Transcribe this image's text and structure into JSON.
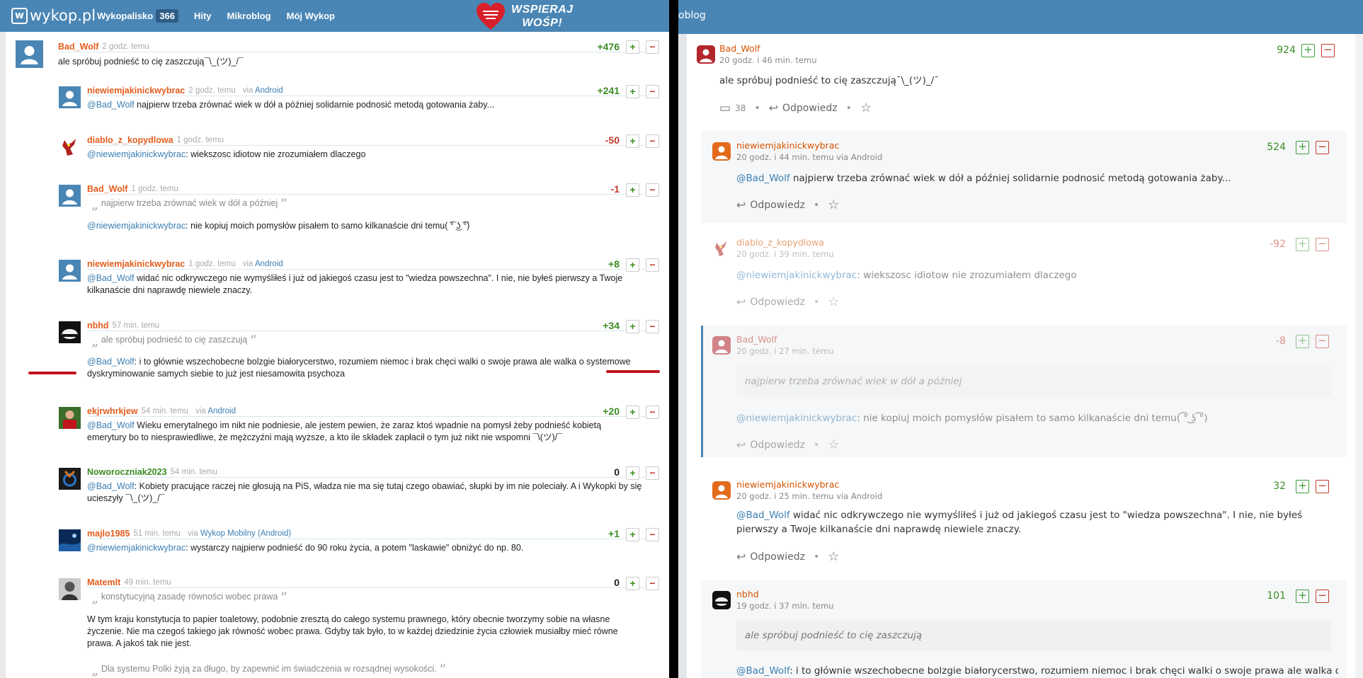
{
  "left": {
    "logo": "wykop.pl",
    "nav": {
      "wykopalisko": "Wykopalisko",
      "wykopalisko_count": "366",
      "hity": "Hity",
      "mikroblog": "Mikroblog",
      "moj_wykop": "Mój Wykop"
    },
    "banner": {
      "line1": "WSPIERAJ",
      "line2": "WOŚP!"
    },
    "entries": [
      {
        "nick": "Bad_Wolf",
        "time": "2 godz. temu",
        "score": "+476",
        "body": "ale spróbuj podnieść to cię zaszczują¯\\_(ツ)_/¯"
      },
      {
        "nick": "niewiemjakinickwybrac",
        "time": "2 godz. temu",
        "via_label": "via",
        "via": "Android",
        "score": "+241",
        "mention": "@Bad_Wolf",
        "body": " najpierw trzeba zrównać wiek w dół a później solidarnie podnosić metodą gotowania żaby..."
      },
      {
        "nick": "diablo_z_kopydlowa",
        "time": "1 godz. temu",
        "score": "-50",
        "mention": "@niewiemjakinickwybrac",
        "body": ": wiekszosc idiotow nie zrozumiałem dlaczego"
      },
      {
        "nick": "Bad_Wolf",
        "time": "1 godz. temu",
        "score": "-1",
        "quote": "najpierw trzeba zrównać wiek w dół a później",
        "mention": "@niewiemjakinickwybrac",
        "body": ": nie kopiuj moich pomysłów pisałem to samo kilkanaście dni temu( ͡° ͜ʖ ͡°)"
      },
      {
        "nick": "niewiemjakinickwybrac",
        "time": "1 godz. temu",
        "via_label": "via",
        "via": "Android",
        "score": "+8",
        "mention": "@Bad_Wolf",
        "body": " widać nic odkrywczego nie wymyśliłeś i już od jakiegoś czasu jest to \"wiedza powszechna\". I nie, nie byłeś pierwszy a Twoje kilkanaście dni naprawdę niewiele znaczy."
      },
      {
        "nick": "nbhd",
        "time": "57 min. temu",
        "score": "+34",
        "quote": "ale spróbuj podnieść to cię zaszczują",
        "mention": "@Bad_Wolf",
        "body": ": i to głównie wszechobecne bolzgie białorycerstwo, rozumiem niemoc i brak chęci walki o swoje prawa ale walka o systemowe dyskryminowanie samych siebie to już jest niesamowita psychoza"
      },
      {
        "nick": "ekjrwhrkjew",
        "time": "54 min. temu",
        "via_label": "via",
        "via": "Android",
        "score": "+20",
        "mention": "@Bad_Wolf",
        "body": " Wieku emerytalnego im nikt nie podniesie, ale jestem pewien, że zaraz ktoś wpadnie na pomysł żeby podnieść kobietą emerytury bo to niesprawiedliwe, że mężczyźni mają wyższe, a kto ile składek zapłacił o tym już nikt nie wspomni ¯\\(ツ)/¯"
      },
      {
        "nick": "Noworoczniak2023",
        "time": "54 min. temu",
        "score": "0",
        "mention": "@Bad_Wolf",
        "body": ": Kobiety pracujące raczej nie głosują na PiS, władza nie ma się tutaj czego obawiać, słupki by im nie poleciały. A i Wykopki by się ucieszyły ¯\\_(ツ)_/¯"
      },
      {
        "nick": "majlo1985",
        "time": "51 min. temu",
        "via_label": "via",
        "via": "Wykop Mobilny (Android)",
        "score": "+1",
        "mention": "@niewiemjakinickwybrac",
        "body": ": wystarczy najpierw podnieść do 90 roku życia, a potem \"laskawie\" obniżyć do np. 80."
      },
      {
        "nick": "Matemlt",
        "time": "49 min. temu",
        "score": "0",
        "quote": "konstytucyjną zasadę równości wobec prawa",
        "body": "W tym kraju konstytucja to papier toaletowy, podobnie zresztą do całego systemu prawnego, który obecnie tworzymy sobie na własne życzenie. Nie ma czegoś takiego jak równość wobec prawa. Gdyby tak było, to w każdej dziedzinie życia człowiek musiałby mieć równe prawa. A jakoś tak nie jest.",
        "quote2": "Dla systemu Polki żyją za długo, by zapewnić im świadczenia w rozsądnej wysokości."
      }
    ]
  },
  "right": {
    "header_title": "oblog",
    "reply_label": "Odpowiedz",
    "entries": [
      {
        "nick": "Bad_Wolf",
        "time": "20 godz. i 46 min. temu",
        "score": "924",
        "body": "ale spróbuj podnieść to cię zaszczują¯\\_(ツ)_/¯",
        "comments": "38"
      },
      {
        "nick": "niewiemjakinickwybrac",
        "time": "20 godz. i 44 min. temu via ",
        "via": "Android",
        "score": "524",
        "mention": "@Bad_Wolf",
        "body": " najpierw trzeba zrównać wiek w dół a później solidarnie podnosić metodą gotowania żaby..."
      },
      {
        "nick": "diablo_z_kopydlowa",
        "time": "20 godz. i 39 min. temu",
        "score": "-92",
        "mention": "@niewiemjakinickwybrac",
        "body": ": wiekszosc idiotow nie zrozumiałem dlaczego"
      },
      {
        "nick": "Bad_Wolf",
        "time": "20 godz. i 27 min. temu",
        "score": "-8",
        "quote": "najpierw trzeba zrównać wiek w dół a później",
        "mention": "@niewiemjakinickwybrac",
        "body": ": nie kopiuj moich pomysłów pisałem to samo kilkanaście dni temu( ͡° ͜ʖ ͡°)"
      },
      {
        "nick": "niewiemjakinickwybrac",
        "time": "20 godz. i 25 min. temu via ",
        "via": "Android",
        "score": "32",
        "mention": "@Bad_Wolf",
        "body": " widać nic odkrywczego nie wymyśliłeś i już od jakiegoś czasu jest to \"wiedza powszechna\". I nie, nie byłeś pierwszy a Twoje kilkanaście dni naprawdę niewiele znaczy."
      },
      {
        "nick": "nbhd",
        "time": "19 godz. i 37 min. temu",
        "score": "101",
        "quote": "ale spróbuj podnieść to cię zaszczują",
        "mention": "@Bad_Wolf",
        "body": ": i to głównie wszechobecne bolzgie białorycerstwo, rozumiem niemoc i brak chęci walki o swoje prawa ale walka o"
      }
    ]
  },
  "colors": {
    "header_blue": "#4a86b5",
    "nick_orange": "#e35d1e",
    "positive": "#3b8c23",
    "negative": "#c0392b",
    "mention_blue": "#3c7fb3",
    "annotation_red": "#c0151d"
  }
}
